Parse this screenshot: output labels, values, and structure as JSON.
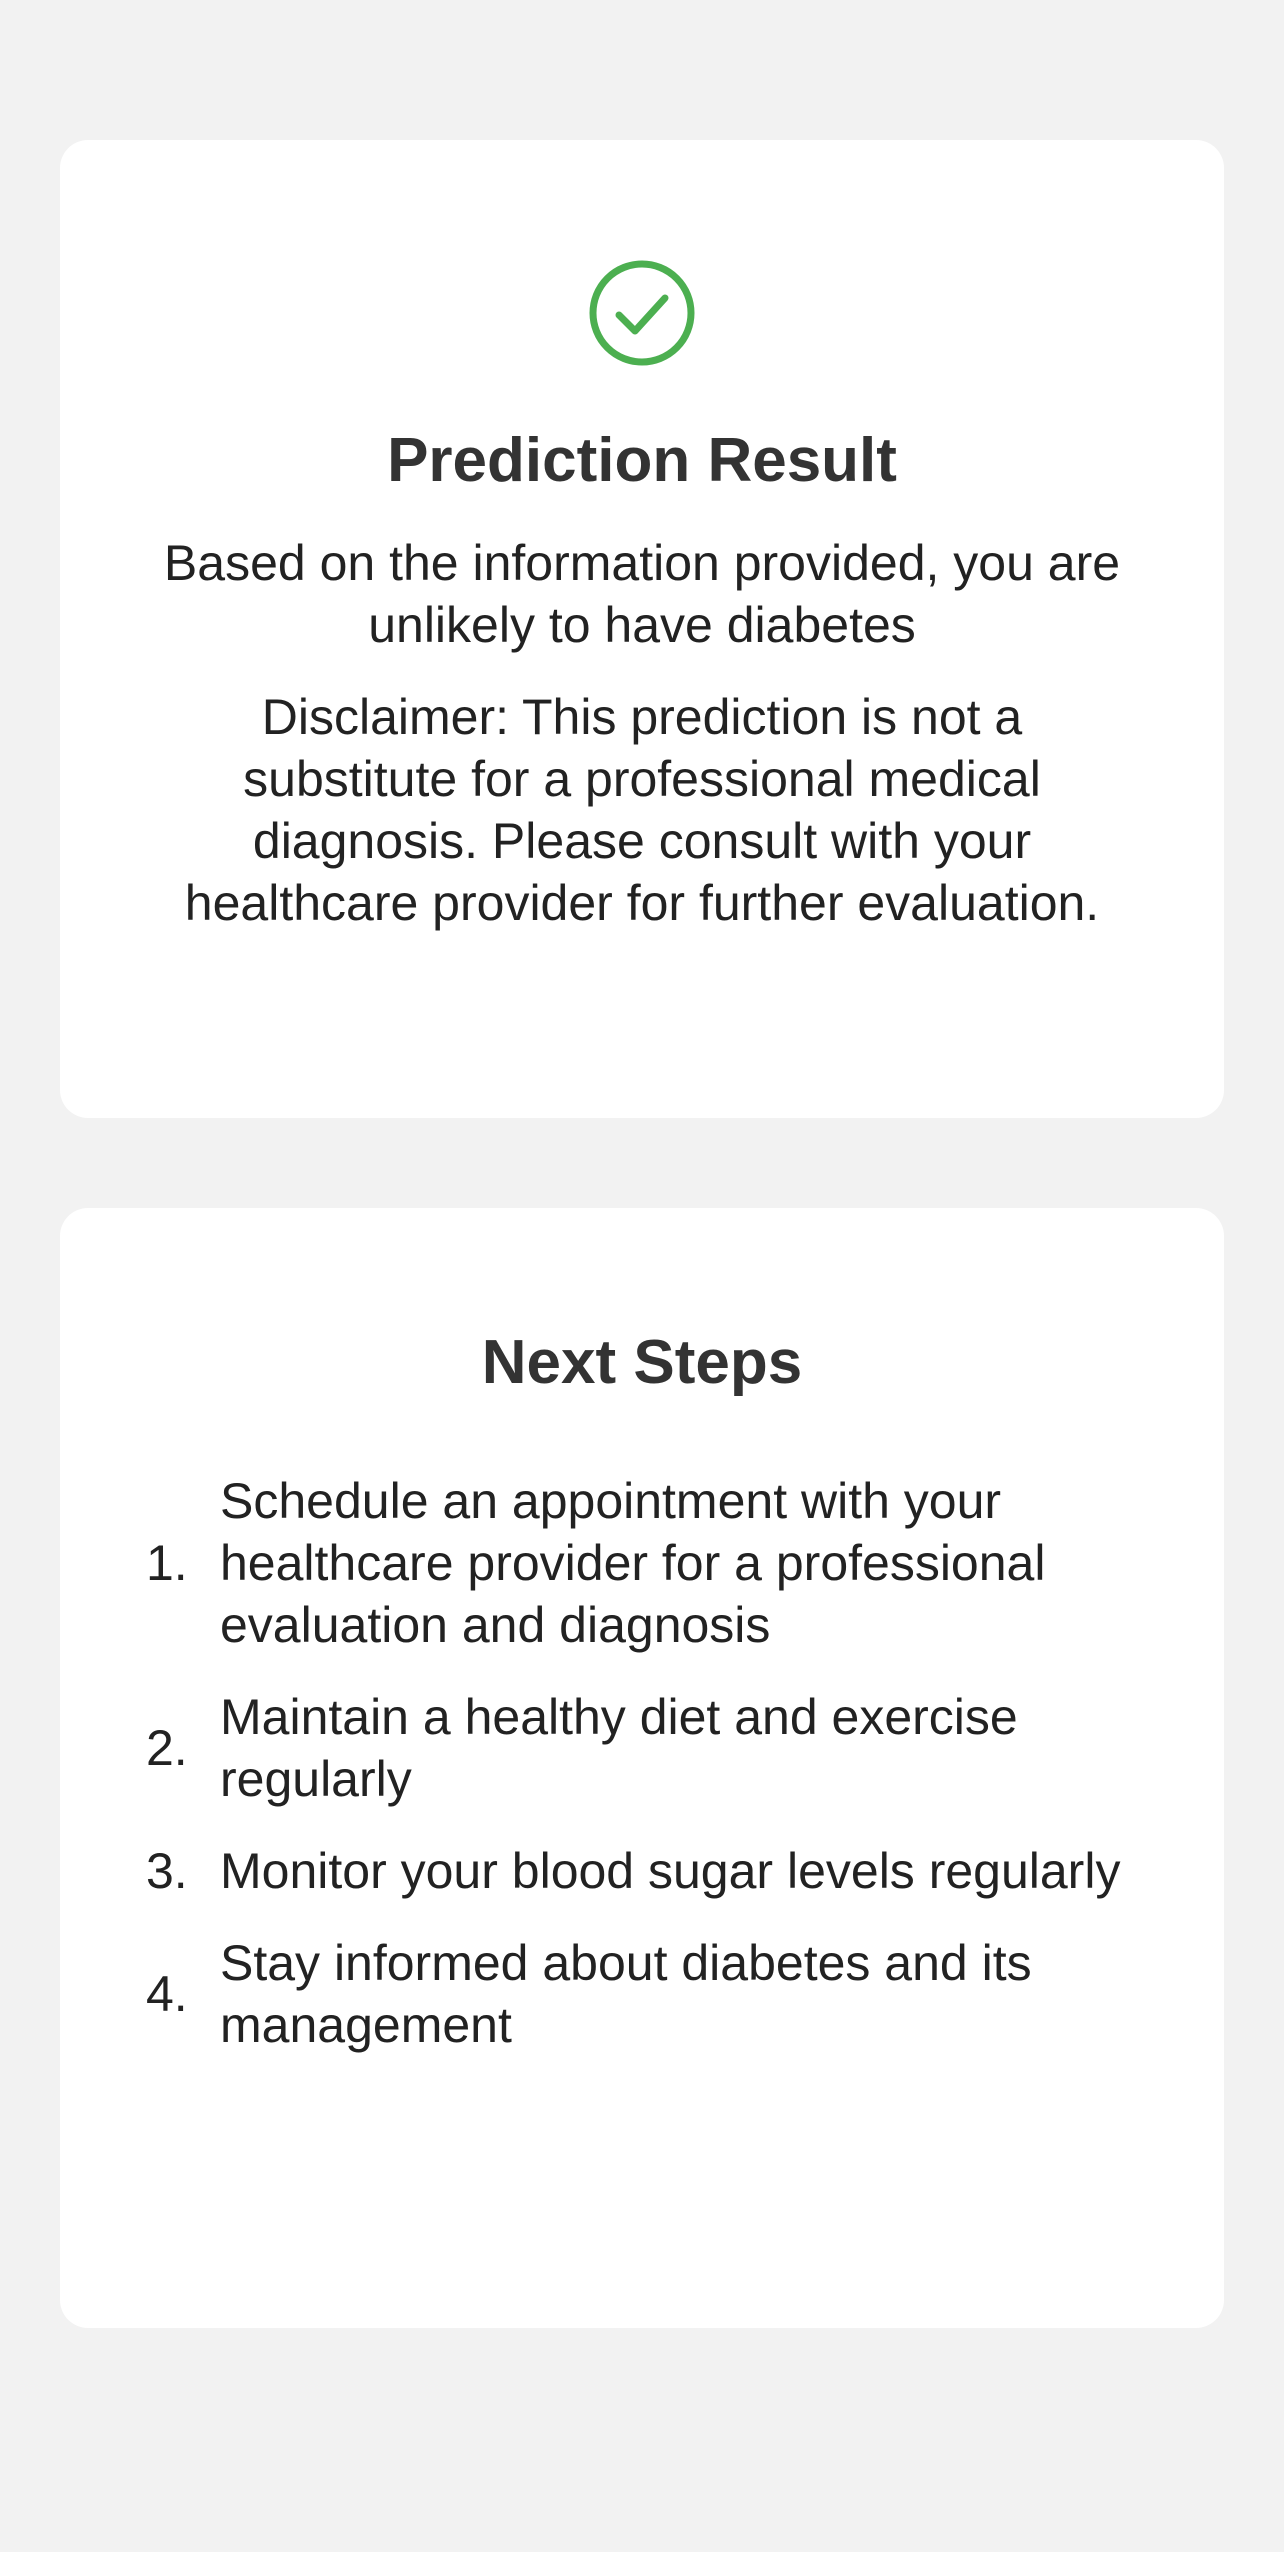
{
  "result": {
    "title": "Prediction Result",
    "message": "Based on the information provided, you are unlikely to have diabetes",
    "disclaimer": "Disclaimer: This prediction is not a substitute for a professional medical diagnosis. Please consult with your healthcare provider for further evaluation.",
    "icon": "check-circle-icon",
    "icon_color": "#4caf50"
  },
  "next_steps": {
    "title": "Next Steps",
    "items": [
      {
        "number": "1.",
        "text": "Schedule an appointment with your healthcare provider for a professional evaluation and diagnosis"
      },
      {
        "number": "2.",
        "text": "Maintain a healthy diet and exercise regularly"
      },
      {
        "number": "3.",
        "text": "Monitor your blood sugar levels regularly"
      },
      {
        "number": "4.",
        "text": "Stay informed about diabetes and its management"
      }
    ]
  },
  "colors": {
    "background": "#f2f2f2",
    "card": "#ffffff",
    "title": "#333333",
    "text": "#222222",
    "accent": "#4caf50"
  }
}
